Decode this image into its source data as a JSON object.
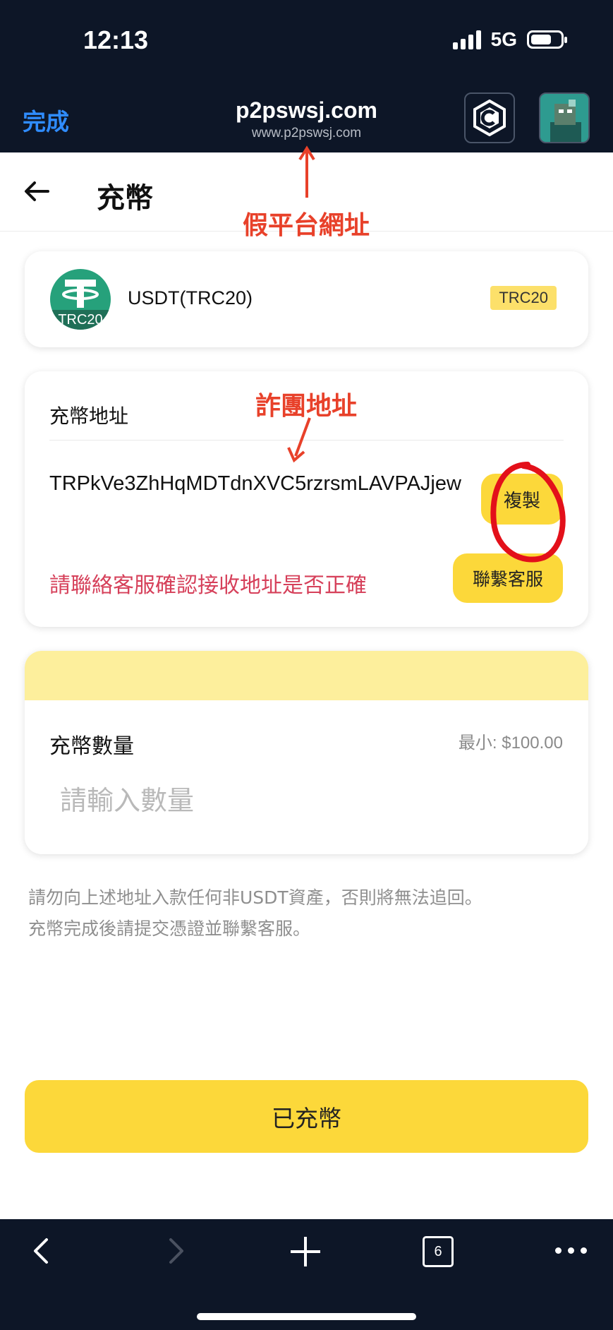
{
  "status": {
    "time": "12:13",
    "network": "5G"
  },
  "browser": {
    "done_label": "完成",
    "site_title": "p2pswsj.com",
    "site_url": "www.p2pswsj.com",
    "tab_count": "6"
  },
  "header": {
    "title": "充幣"
  },
  "annotations": {
    "fake_site": "假平台網址",
    "scam_address": "詐團地址"
  },
  "coin": {
    "name": "USDT(TRC20)",
    "badge": "TRC20",
    "icon_chain_label": "TRC20"
  },
  "address": {
    "label": "充幣地址",
    "value": "TRPkVe3ZhHqMDTdnXVC5rzrsmLAVPAJjew",
    "copy_label": "複製",
    "warning": "請聯絡客服確認接收地址是否正確",
    "service_label": "聯繫客服"
  },
  "amount": {
    "label": "充幣數量",
    "min_label": "最小: $100.00",
    "placeholder": "請輸入數量"
  },
  "notice": {
    "line1": "請勿向上述地址入款任何非USDT資產，否則將無法追回。",
    "line2": "充幣完成後請提交憑證並聯繫客服。"
  },
  "submit_label": "已充幣",
  "colors": {
    "accent": "#fcd83a",
    "warning": "#d6405a",
    "annotation": "#e8412a",
    "dark_bar": "#0d1627"
  }
}
